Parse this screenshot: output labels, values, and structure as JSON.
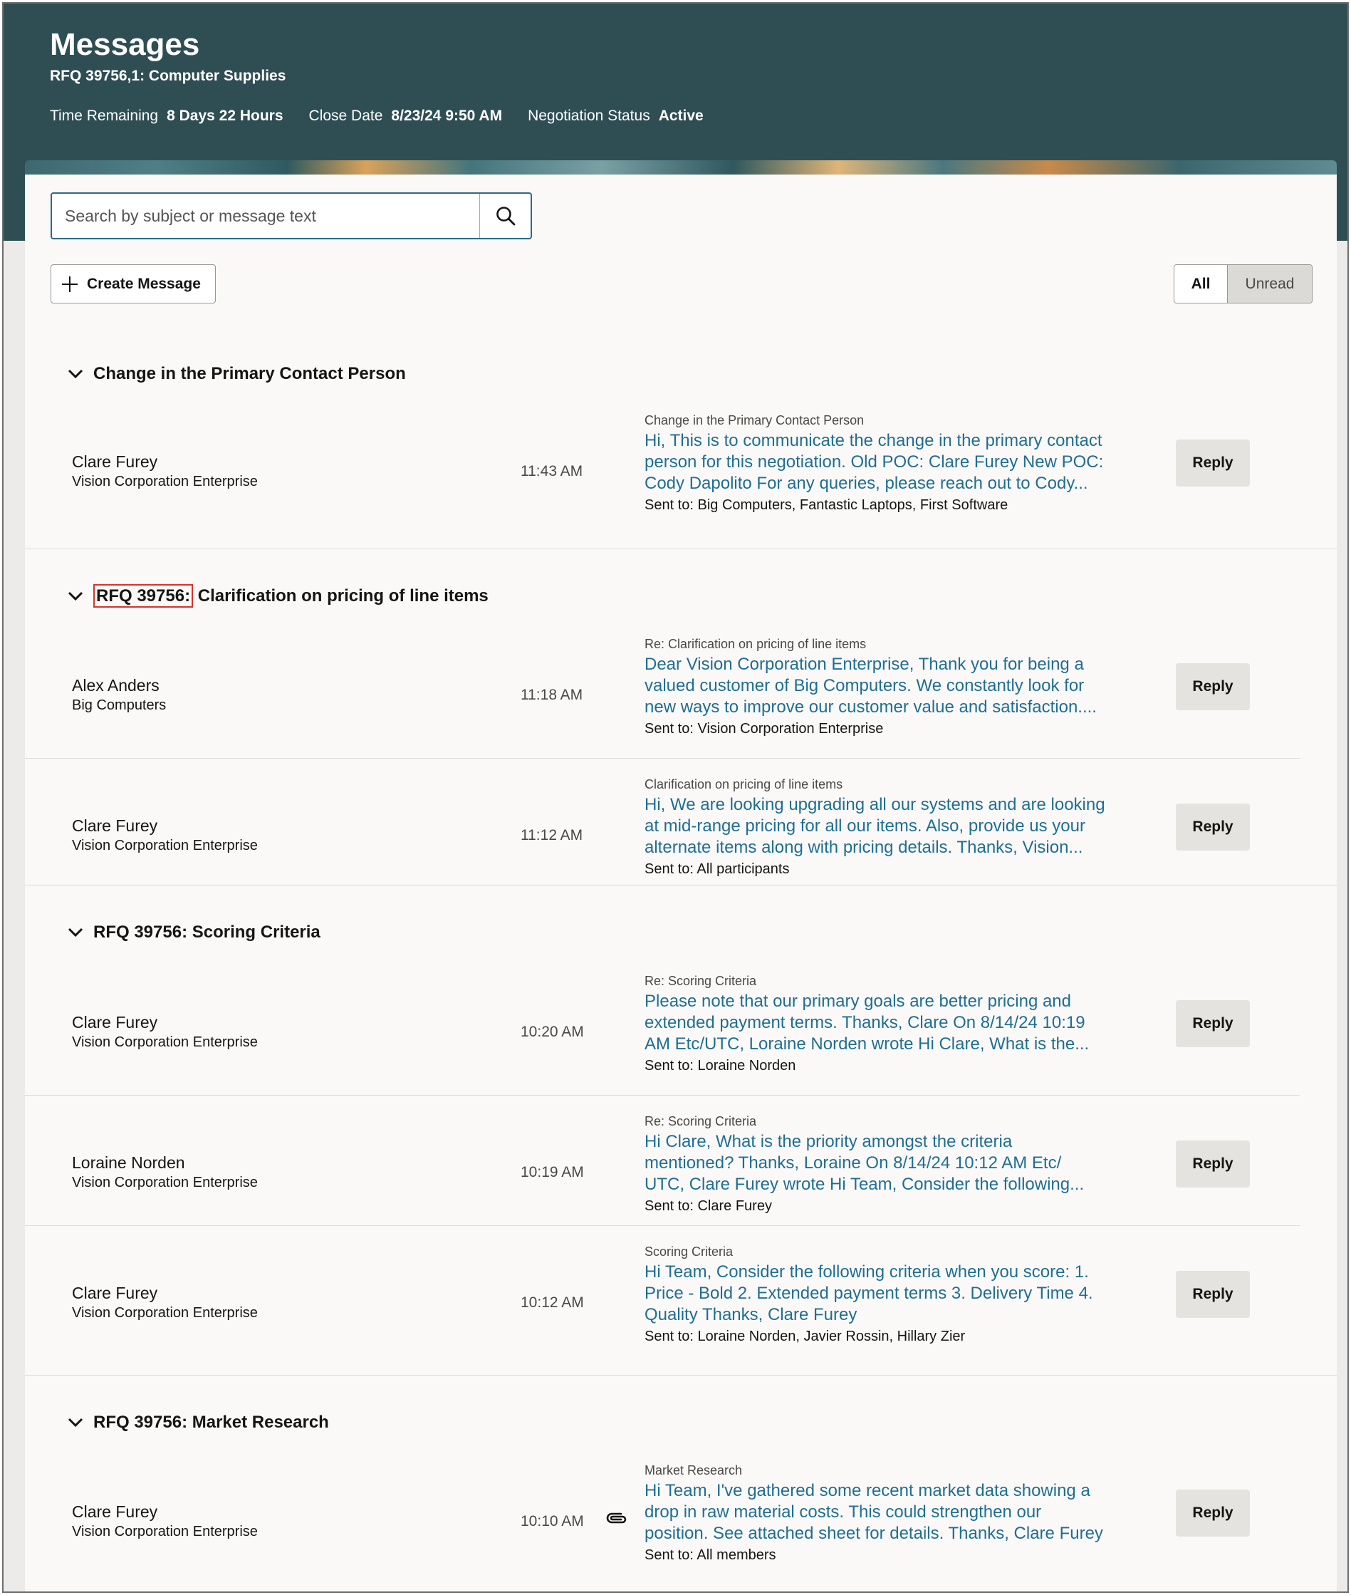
{
  "header": {
    "title": "Messages",
    "subtitle": "RFQ 39756,1: Computer Supplies",
    "meta": [
      {
        "label": "Time Remaining",
        "value": "8 Days 22 Hours"
      },
      {
        "label": "Close Date",
        "value": "8/23/24 9:50 AM"
      },
      {
        "label": "Negotiation Status",
        "value": "Active"
      }
    ]
  },
  "search": {
    "placeholder": "Search by subject or message text",
    "value": ""
  },
  "toolbar": {
    "create_label": "Create Message",
    "filter_all": "All",
    "filter_unread": "Unread"
  },
  "reply_label": "Reply",
  "groups": [
    {
      "title": "Change in the Primary Contact Person",
      "messages": [
        {
          "sender": "Clare Furey",
          "org": "Vision Corporation Enterprise",
          "time": "11:43 AM",
          "subject": "Change in the Primary Contact Person",
          "body": [
            "Hi, This is to communicate the change in the primary contact",
            "person for this negotiation. Old POC: Clare Furey New POC:",
            "Cody Dapolito For any queries, please reach out to Cody..."
          ],
          "sent": "Sent to: Big Computers, Fantastic Laptops, First Software"
        }
      ]
    },
    {
      "title_prefix": "RFQ 39756:",
      "title": "Clarification on pricing of line items",
      "messages": [
        {
          "sender": "Alex Anders",
          "org": "Big Computers",
          "time": "11:18 AM",
          "subject": "Re: Clarification on pricing of line items",
          "body": [
            "Dear Vision Corporation Enterprise, Thank you for being a",
            "valued customer of Big Computers. We constantly look for",
            "new ways to improve our customer value and satisfaction...."
          ],
          "sent": "Sent to: Vision Corporation Enterprise"
        },
        {
          "sender": "Clare Furey",
          "org": "Vision Corporation Enterprise",
          "time": "11:12 AM",
          "subject": "Clarification on pricing of line items",
          "body": [
            "Hi, We are looking upgrading all our systems and are looking",
            "at mid-range pricing for all our items. Also, provide us your",
            "alternate items along with pricing details. Thanks, Vision..."
          ],
          "sent": "Sent to: All participants"
        }
      ]
    },
    {
      "title": "RFQ 39756: Scoring Criteria",
      "messages": [
        {
          "sender": "Clare Furey",
          "org": "Vision Corporation Enterprise",
          "time": "10:20 AM",
          "subject": "Re: Scoring Criteria",
          "body": [
            "Please note that our primary goals are better pricing and",
            "extended payment terms. Thanks, Clare On 8/14/24 10:19",
            "AM Etc/UTC, Loraine Norden wrote Hi Clare, What is the..."
          ],
          "sent": "Sent to: Loraine Norden"
        },
        {
          "sender": "Loraine Norden",
          "org": "Vision Corporation Enterprise",
          "time": "10:19 AM",
          "subject": "Re: Scoring Criteria",
          "body": [
            "Hi Clare, What is the priority amongst the criteria",
            "mentioned? Thanks, Loraine On 8/14/24 10:12 AM Etc/",
            "UTC, Clare Furey wrote Hi Team, Consider the following..."
          ],
          "sent": "Sent to: Clare Furey"
        },
        {
          "sender": "Clare Furey",
          "org": "Vision Corporation Enterprise",
          "time": "10:12 AM",
          "subject": "Scoring Criteria",
          "body": [
            "Hi Team, Consider the following criteria when you score: 1.",
            "Price - Bold 2. Extended payment terms 3. Delivery Time 4.",
            "Quality Thanks, Clare Furey"
          ],
          "sent": "Sent to: Loraine Norden, Javier Rossin, Hillary Zier"
        }
      ]
    },
    {
      "title": "RFQ 39756: Market Research",
      "messages": [
        {
          "sender": "Clare Furey",
          "org": "Vision Corporation Enterprise",
          "time": "10:10 AM",
          "subject": "Market Research",
          "body": [
            "Hi Team, I've gathered some recent market data showing a",
            "drop in raw material costs. This could strengthen our",
            "position. See attached sheet for details. Thanks, Clare Furey"
          ],
          "sent": "Sent to: All members"
        }
      ]
    }
  ],
  "colors": {
    "header_bg": "#2f4e54",
    "link": "#1e6e94",
    "highlight_box": "#d9322b"
  }
}
